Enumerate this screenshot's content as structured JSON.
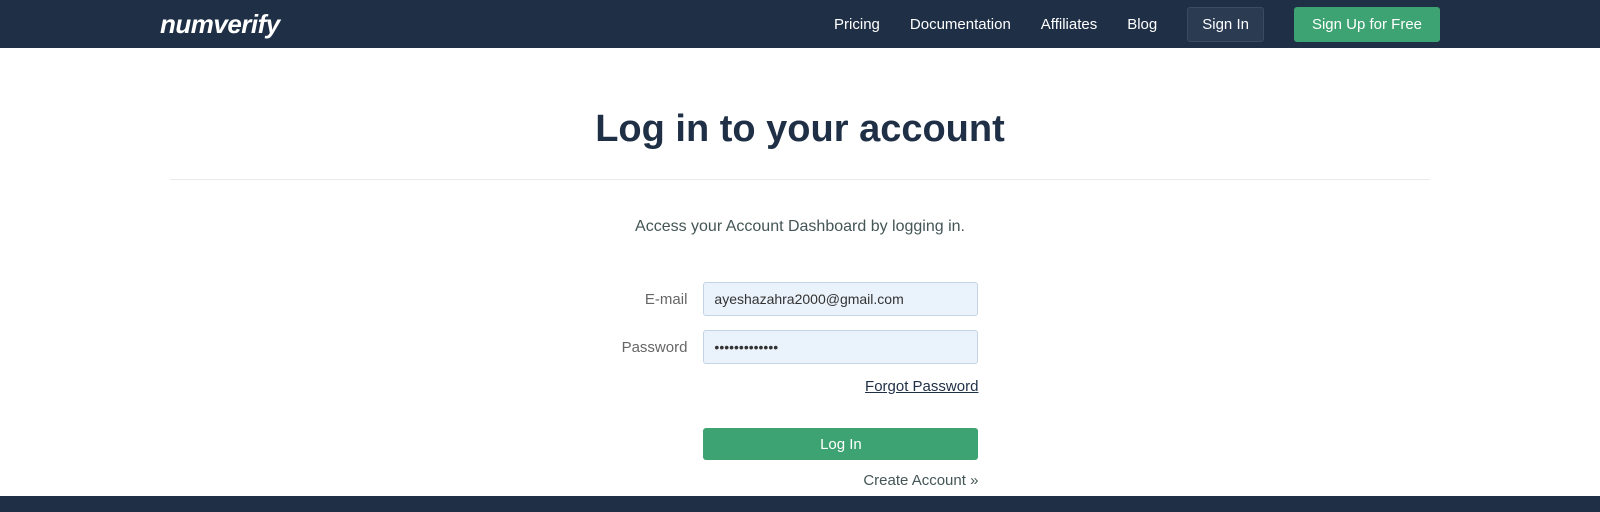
{
  "header": {
    "logo": "numverify",
    "nav": {
      "pricing": "Pricing",
      "documentation": "Documentation",
      "affiliates": "Affiliates",
      "blog": "Blog"
    },
    "signin": "Sign In",
    "signup": "Sign Up for Free"
  },
  "main": {
    "title": "Log in to your account",
    "subtitle": "Access your Account Dashboard by logging in.",
    "form": {
      "email_label": "E-mail",
      "email_value": "ayeshazahra2000@gmail.com",
      "password_label": "Password",
      "password_value": "•••••••••••••",
      "forgot_password": "Forgot Password",
      "login_button": "Log In",
      "create_account": "Create Account »"
    }
  }
}
